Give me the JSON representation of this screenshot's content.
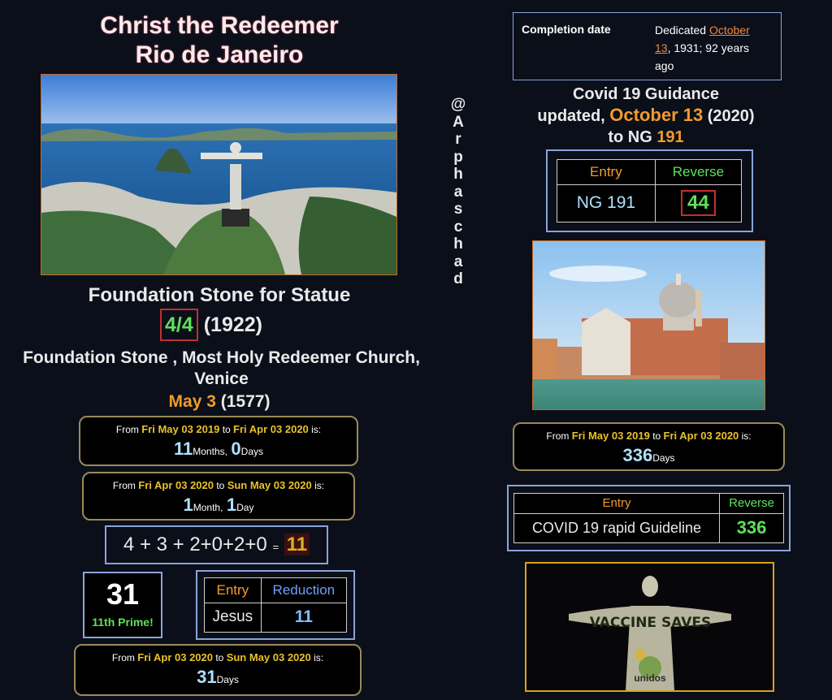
{
  "left": {
    "title_line1": "Christ the Redeemer",
    "title_line2": "Rio de Janeiro",
    "foundation_heading": "Foundation Stone for Statue",
    "foundation_date_boxed": "4/4",
    "foundation_year": "(1922)",
    "venice_heading_line1": "Foundation Stone , Most Holy Redeemer Church,",
    "venice_heading_line2": "Venice",
    "venice_date": "May 3",
    "venice_year": "(1577)",
    "box1": {
      "from": "From",
      "d1": "Fri May 03 2019",
      "to": "to",
      "d2": "Fri Apr 03 2020",
      "is": "is:",
      "n1": "11",
      "u1": "Months,",
      "n2": "0",
      "u2": "Days"
    },
    "box2": {
      "from": "From",
      "d1": "Fri Apr 03 2020",
      "to": "to",
      "d2": "Sun May 03 2020",
      "is": "is:",
      "n1": "1",
      "u1": "Month,",
      "n2": "1",
      "u2": "Day"
    },
    "equation": "4 + 3 + 2+0+2+0",
    "equation_eq": "=",
    "equation_result": "11",
    "prime_number": "31",
    "prime_label": "11th Prime!",
    "table": {
      "h1": "Entry",
      "h2": "Reduction",
      "c1": "Jesus",
      "c2": "11"
    },
    "box3": {
      "from": "From",
      "d1": "Fri Apr 03 2020",
      "to": "to",
      "d2": "Sun May 03 2020",
      "is": "is:",
      "n1": "31",
      "u1": "Days"
    }
  },
  "vertical_handle": [
    "@",
    "A",
    "r",
    "p",
    "h",
    "a",
    "s",
    "c",
    "h",
    "a",
    "d"
  ],
  "right": {
    "completion_label": "Completion date",
    "completion_pre": "Dedicated ",
    "completion_link1": "October",
    "completion_link2": "13",
    "completion_post": ", 1931; 92 years",
    "completion_post2": "ago",
    "covid_line1": "Covid 19 Guidance",
    "covid_line2_pre": "updated, ",
    "covid_line2_date": "October 13",
    "covid_line2_post": " (2020)",
    "covid_line3_pre": "to NG ",
    "covid_line3_num": "191",
    "table1": {
      "h1": "Entry",
      "h2": "Reverse",
      "c1": "NG 191",
      "c2": "44"
    },
    "box": {
      "from": "From",
      "d1": "Fri May 03 2019",
      "to": "to",
      "d2": "Fri Apr 03 2020",
      "is": "is:",
      "n1": "336",
      "u1": "Days"
    },
    "table2": {
      "h1": "Entry",
      "h2": "Reverse",
      "c1": "COVID 19 rapid Guideline",
      "c2": "336"
    },
    "statue_banner": "VACCINE SAVES",
    "statue_logo": "unidos"
  }
}
